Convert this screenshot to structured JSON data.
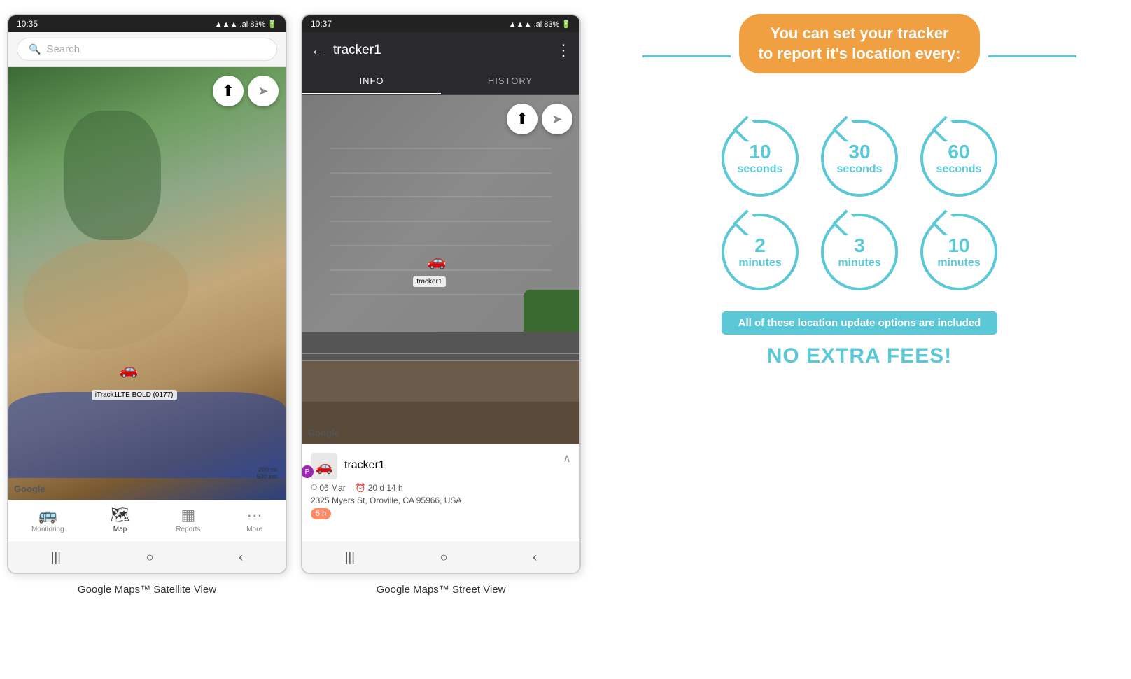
{
  "phone1": {
    "status_time": "10:35",
    "battery": "83%",
    "search_placeholder": "Search",
    "map_type": "satellite",
    "tracker_label": "iTrack1LTE BOLD (0177)",
    "google_logo": "Google",
    "scale_200mi": "200 mi",
    "scale_500km": "500 km",
    "nav_items": [
      {
        "label": "Monitoring",
        "icon": "🚌",
        "active": false
      },
      {
        "label": "Map",
        "icon": "🗺",
        "active": true
      },
      {
        "label": "Reports",
        "icon": "▦",
        "active": false
      },
      {
        "label": "More",
        "icon": "···",
        "active": false
      }
    ],
    "caption": "Google Maps™ Satellite View"
  },
  "phone2": {
    "status_time": "10:37",
    "battery": "83%",
    "header_title": "tracker1",
    "tabs": [
      {
        "label": "INFO",
        "active": true
      },
      {
        "label": "HISTORY",
        "active": false
      }
    ],
    "map_type": "street",
    "google_logo": "Google",
    "tracker_label": "tracker1",
    "info": {
      "tracker_name": "tracker1",
      "date": "06 Mar",
      "duration": "20 d 14 h",
      "address": "2325 Myers St, Oroville, CA 95966, USA",
      "badge": "5 h"
    },
    "caption": "Google Maps™ Street View"
  },
  "infographic": {
    "title_line1": "You can set your tracker",
    "title_line2": "to report it's location every:",
    "circles": [
      {
        "num": "10",
        "unit": "seconds"
      },
      {
        "num": "30",
        "unit": "seconds"
      },
      {
        "num": "60",
        "unit": "seconds"
      },
      {
        "num": "2",
        "unit": "minutes"
      },
      {
        "num": "3",
        "unit": "minutes"
      },
      {
        "num": "10",
        "unit": "minutes"
      }
    ],
    "included_text": "All of these location update options are included",
    "no_fees": "NO EXTRA FEES!",
    "accent_color": "#f0a040",
    "teal_color": "#5bc8d8"
  }
}
